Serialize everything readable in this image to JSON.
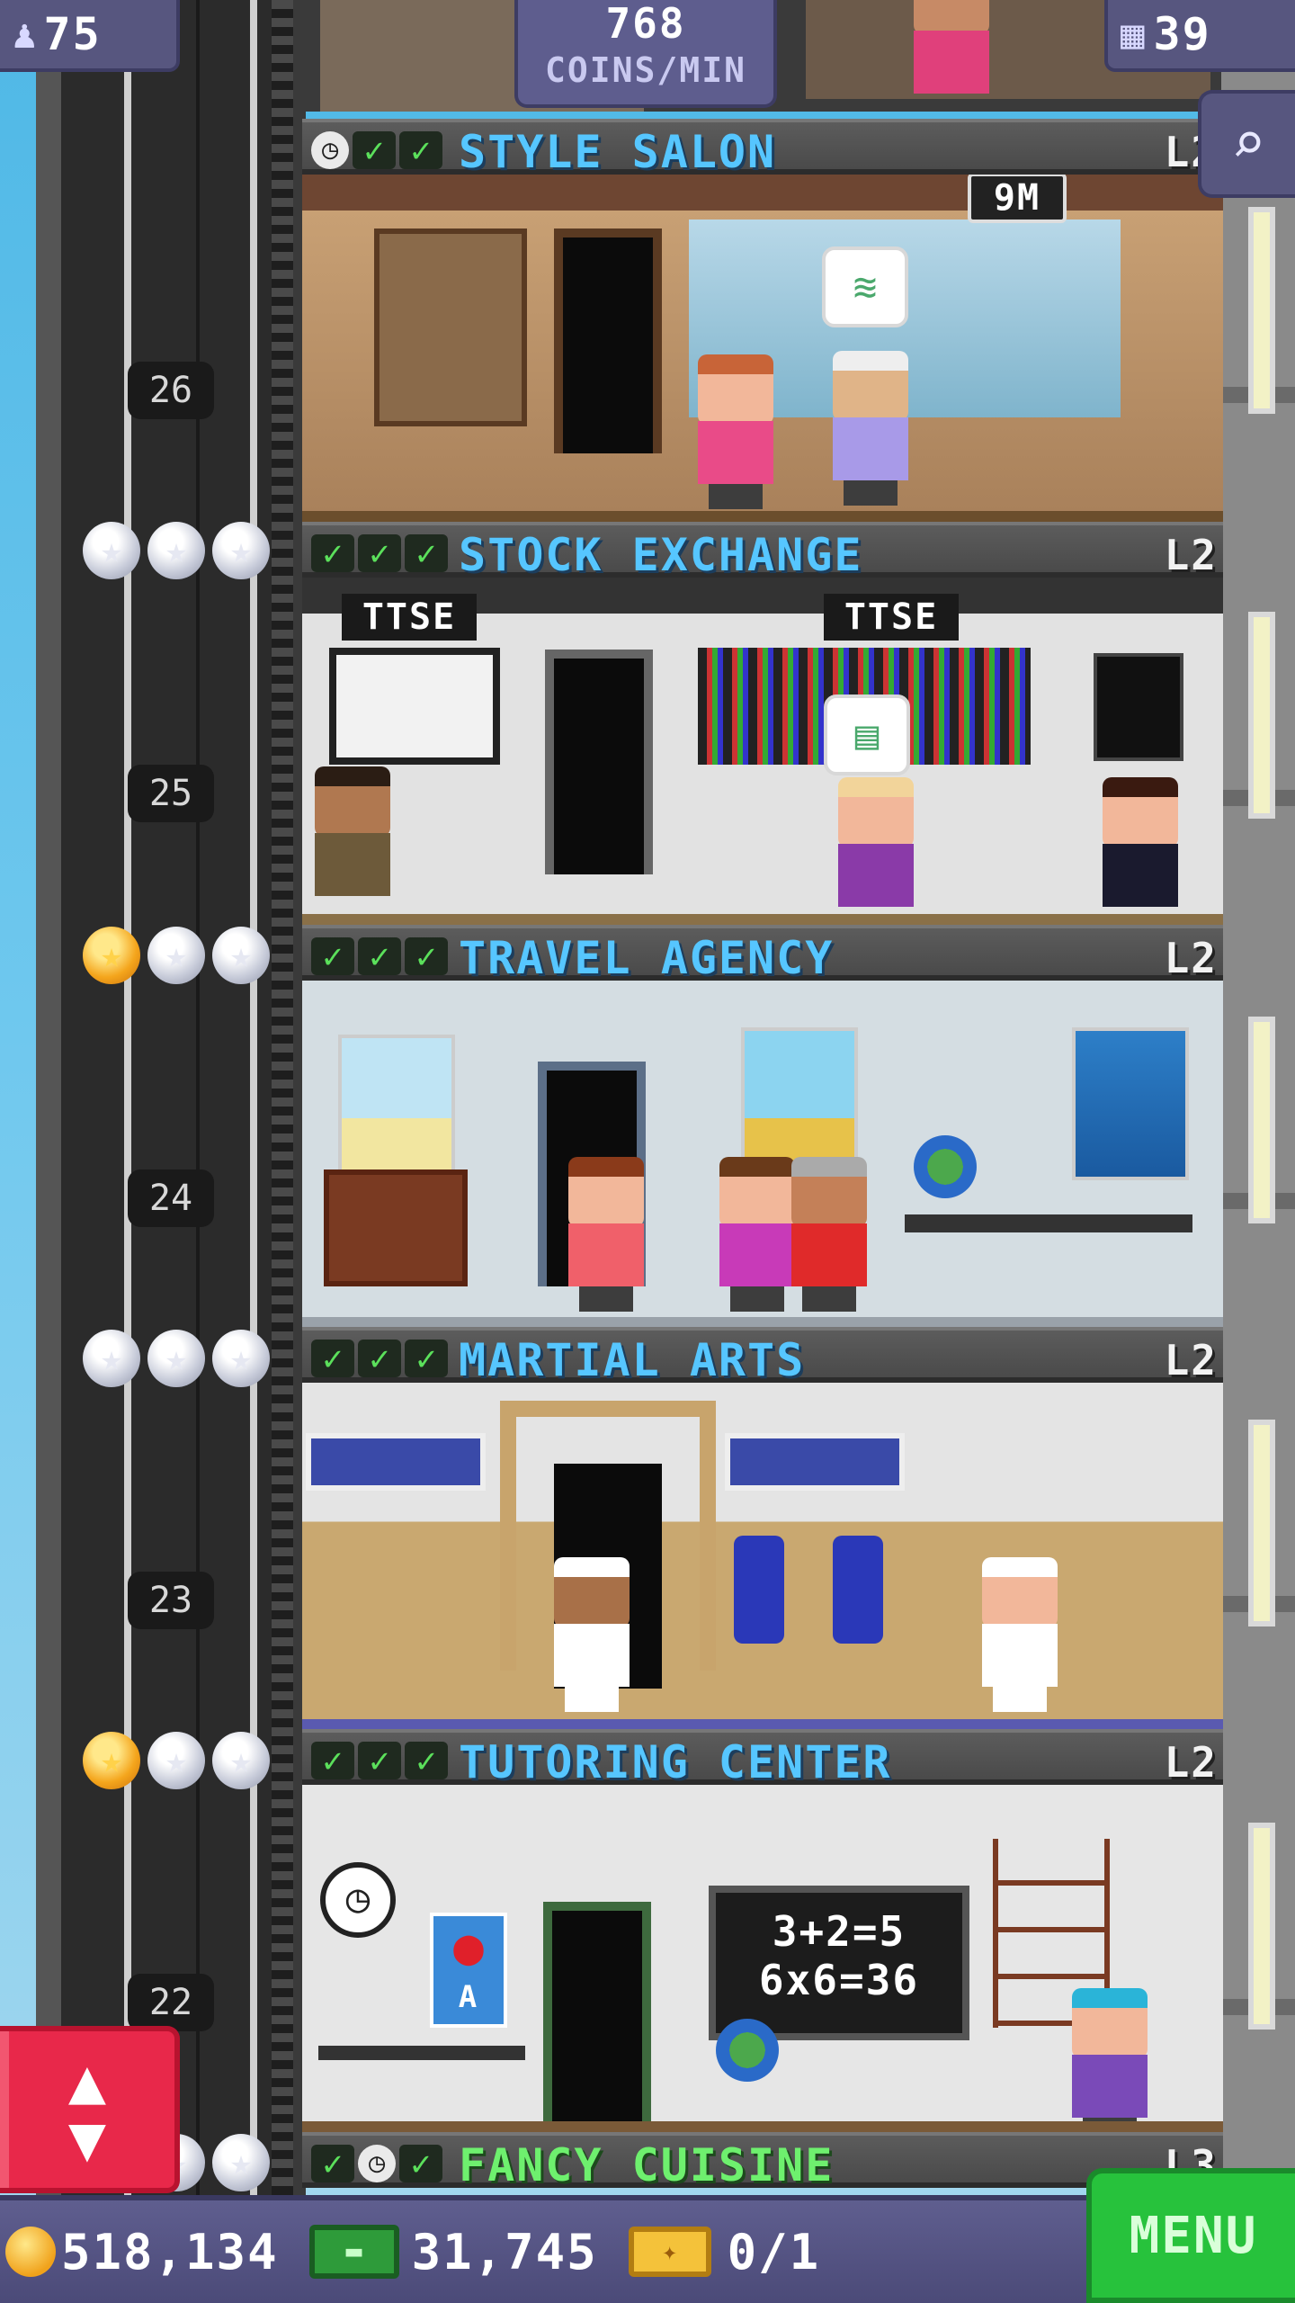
{
  "hud": {
    "population": "75",
    "floors_count": "39",
    "coins_rate_value": "768",
    "coins_rate_unit": "COINS/MIN",
    "timer_badge": "9M"
  },
  "floors": [
    {
      "number": "26",
      "name": "STYLE SALON",
      "level": "L2",
      "checks": [
        "clock",
        "check",
        "check"
      ],
      "stars_gold": 0
    },
    {
      "number": "25",
      "name": "STOCK EXCHANGE",
      "level": "L2",
      "checks": [
        "check",
        "check",
        "check"
      ],
      "stars_gold": 0,
      "signs": [
        "TTSE",
        "TTSE"
      ]
    },
    {
      "number": "24",
      "name": "TRAVEL AGENCY",
      "level": "L2",
      "checks": [
        "check",
        "check",
        "check"
      ],
      "stars_gold": 1
    },
    {
      "number": "23",
      "name": "MARTIAL ARTS",
      "level": "L2",
      "checks": [
        "check",
        "check",
        "check"
      ],
      "stars_gold": 0
    },
    {
      "number": "22",
      "name": "TUTORING CENTER",
      "level": "L2",
      "checks": [
        "check",
        "check",
        "check"
      ],
      "stars_gold": 1,
      "blackboard": [
        "3+2=5",
        "6x6=36"
      ],
      "poster_letter": "A"
    },
    {
      "number": "",
      "name": "FANCY CUISINE",
      "level": "L3",
      "checks": [
        "check",
        "clock",
        "check"
      ]
    }
  ],
  "bottom": {
    "coins": "518,134",
    "bux": "31,745",
    "tickets": "0/1",
    "menu_label": "MENU"
  },
  "colors": {
    "sky": "#4fb8e6",
    "floor_name": "#56c6ff",
    "check_green": "#5be05b",
    "menu_green": "#27c23c",
    "elevator_red": "#e8284a",
    "hud_purple": "#57567f"
  },
  "icons": {
    "population": "person-icon",
    "floors": "building-icon",
    "search": "magnifier-icon",
    "elevator": "up-down-arrows-icon",
    "coin": "coin-icon",
    "bux": "bux-banknote-icon",
    "ticket": "golden-ticket-icon"
  }
}
